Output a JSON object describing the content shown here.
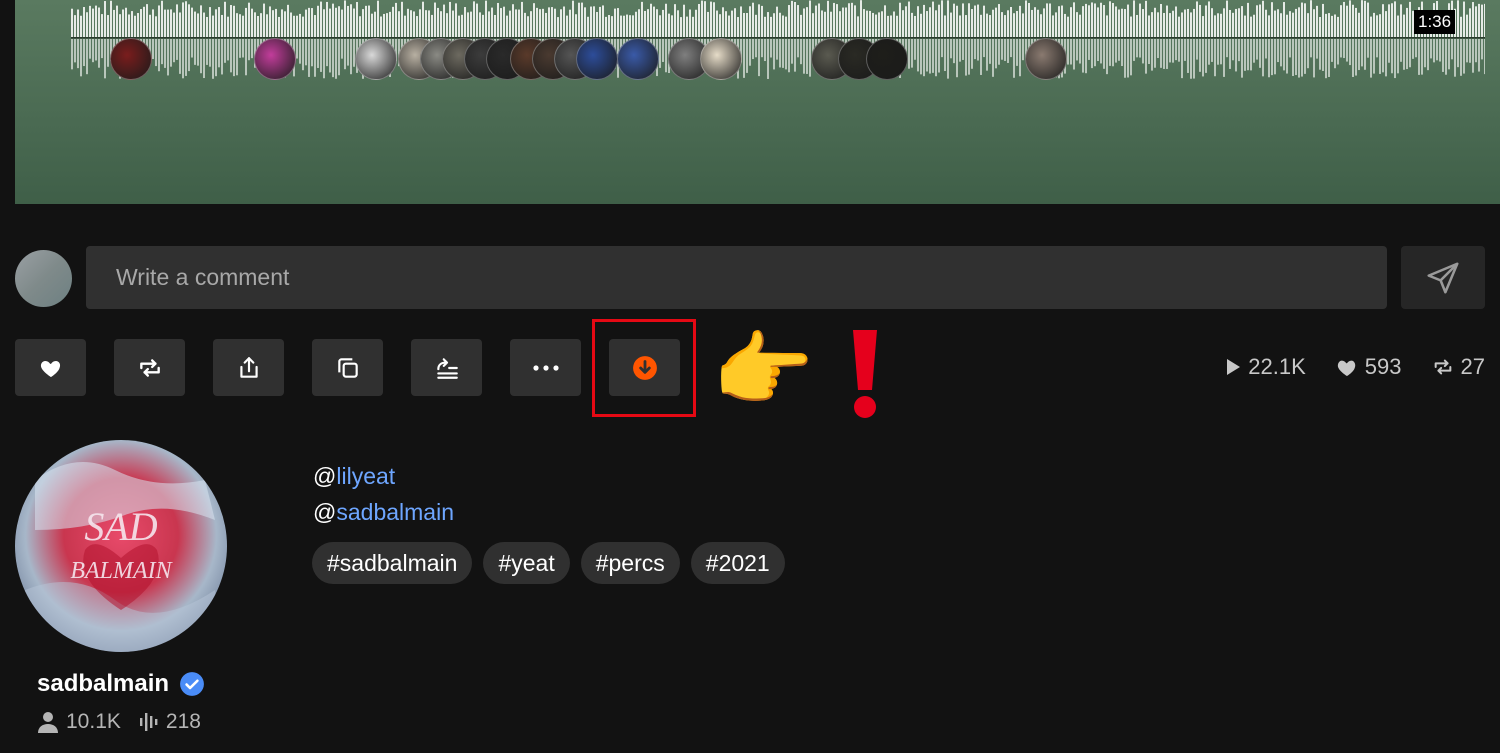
{
  "player": {
    "duration": "1:36",
    "comment_avatars": [
      {
        "color": "#7a1d1d",
        "pos": 110
      },
      {
        "color": "#c23d9b",
        "pos": 254
      },
      {
        "color": "#d9d9d9",
        "pos": 355
      },
      {
        "color": "#b8b0a2",
        "pos": 398
      },
      {
        "color": "#8a8a84",
        "pos": 420
      },
      {
        "color": "#6d6a60",
        "pos": 442
      },
      {
        "color": "#3c3c3c",
        "pos": 464
      },
      {
        "color": "#2a2a2a",
        "pos": 486
      },
      {
        "color": "#5a3a2a",
        "pos": 510
      },
      {
        "color": "#4a3a30",
        "pos": 532
      },
      {
        "color": "#555555",
        "pos": 554
      },
      {
        "color": "#2d4d9a",
        "pos": 576
      },
      {
        "color": "#3a5aa8",
        "pos": 617
      },
      {
        "color": "#7f7f7f",
        "pos": 668
      },
      {
        "color": "#e6dcc8",
        "pos": 700
      },
      {
        "color": "#5a5a50",
        "pos": 811
      },
      {
        "color": "#2a2a24",
        "pos": 838
      },
      {
        "color": "#1e1e1a",
        "pos": 866
      },
      {
        "color": "#8a7a70",
        "pos": 1025
      }
    ]
  },
  "comment": {
    "placeholder": "Write a comment"
  },
  "actions": {
    "buttons": [
      "like",
      "repost",
      "share",
      "copy-link",
      "add-to-playlist",
      "more",
      "download"
    ]
  },
  "stats": {
    "plays": "22.1K",
    "likes": "593",
    "reposts": "27"
  },
  "artist": {
    "name": "sadbalmain",
    "followers": "10.1K",
    "tracks": "218",
    "art_text": "SAD BALMAIN"
  },
  "mentions": [
    {
      "prefix": "@",
      "handle": "lilyeat"
    },
    {
      "prefix": "@",
      "handle": "sadbalmain"
    }
  ],
  "tags": [
    "sadbalmain",
    "yeat",
    "percs",
    "2021"
  ],
  "colors": {
    "background": "#121212",
    "button": "#303030",
    "accent_download": "#ff5500",
    "link": "#6ea6ff",
    "highlight": "#e50914",
    "verified": "#4a8cf7"
  }
}
